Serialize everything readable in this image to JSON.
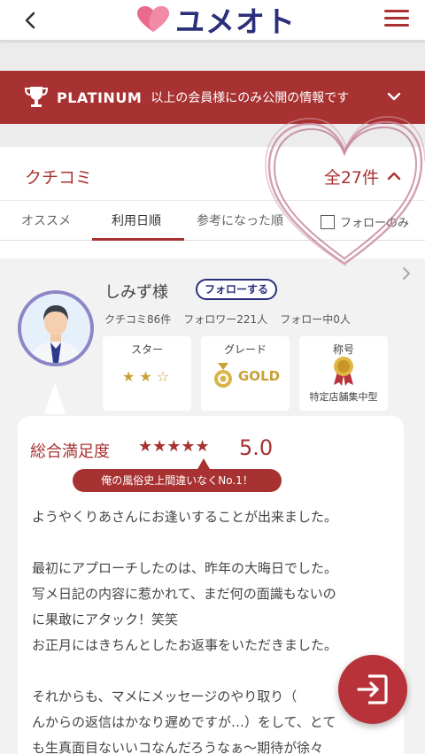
{
  "header": {
    "logo_text": "ユメオト",
    "back_icon": "back-chevron-icon",
    "menu_icon": "hamburger-menu-icon"
  },
  "banner": {
    "strong": "PLATINUM",
    "text": "以上の会員様にのみ公開の情報です"
  },
  "section": {
    "title": "クチコミ",
    "count": "全27件",
    "tabs": [
      "オススメ",
      "利用日順",
      "参考になった順"
    ],
    "active_tab": "利用日順",
    "follow_only_label": "フォローのみ"
  },
  "reviewer": {
    "name": "しみず様",
    "follow_button": "フォローする",
    "stats": [
      "クチコミ86件",
      "フォロワー221人",
      "フォロー中0人"
    ],
    "badges": {
      "star_title": "スター",
      "star_rating": "★★☆",
      "grade_title": "グレード",
      "grade_value": "GOLD",
      "rank_title": "称号",
      "rank_value": "特定店舗集中型"
    }
  },
  "review": {
    "overall_label": "総合満足度",
    "overall_stars": "★★★★★",
    "score": "5.0",
    "headline": "俺の風俗史上間違いなくNo.1！",
    "lines": [
      "ようやくりあさんにお逢いすることが出来ました。",
      "",
      "最初にアプローチしたのは、昨年の大晦日でした。",
      "写メ日記の内容に惹かれて、まだ何の面識もないの",
      "に果敢にアタック！笑笑",
      "お正月にはきちんとしたお返事をいただきました。",
      "",
      "それからも、マメにメッセージのやり取り（",
      "んからの返信はかなり遅めですが…）をして、とて",
      "も生真面目ないいコなんだろうなぁ〜期待が徐々"
    ]
  },
  "colors": {
    "accent": "#a83232",
    "brand_navy": "#2b2f7a",
    "gold": "#c9a13a",
    "avatar_ring": "#8b86c8"
  }
}
